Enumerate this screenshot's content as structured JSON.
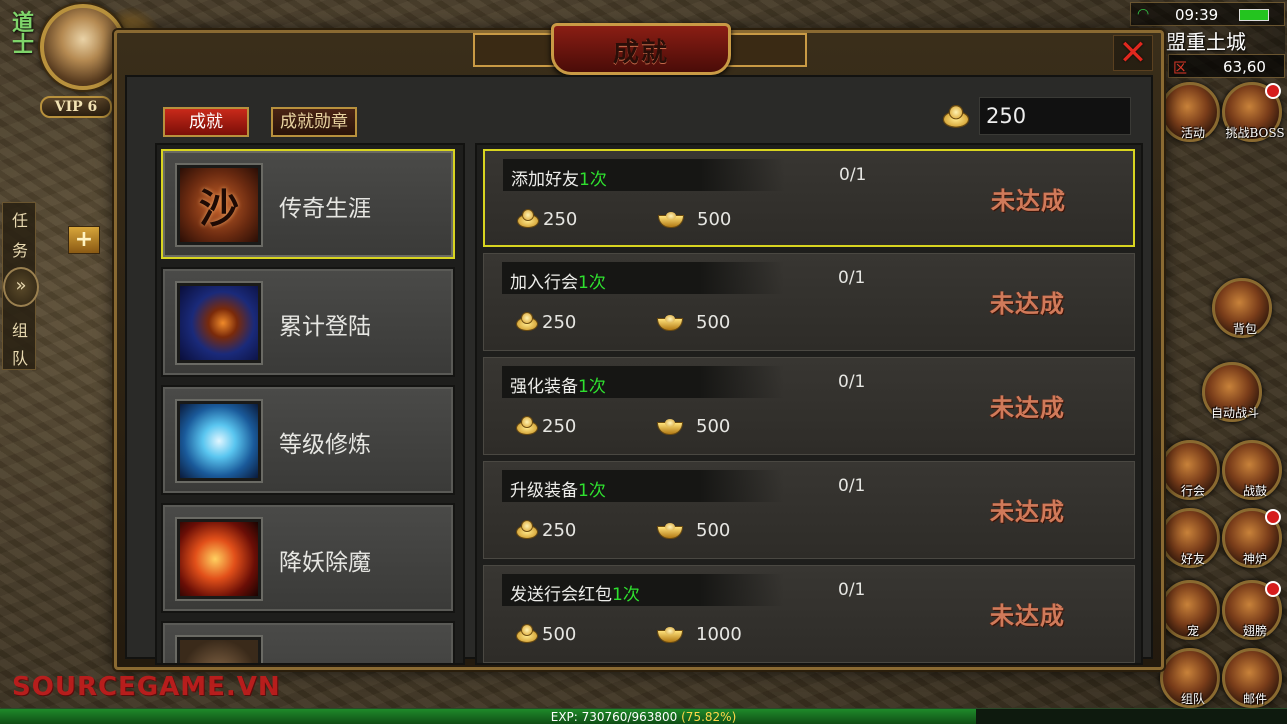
{
  "hud": {
    "player_class": "道士",
    "vip_label": "VIP 6",
    "clock": "09:39",
    "map_name": "盟重土城",
    "zone": "区",
    "coordinates": "63,60",
    "left_tabs": [
      "任",
      "务",
      "组",
      "队"
    ],
    "side_buttons": [
      {
        "label": "活动",
        "badge": false
      },
      {
        "label": "挑战BOSS",
        "badge": true
      },
      {
        "label": "背包",
        "badge": false
      },
      {
        "label": "自动战斗",
        "badge": false
      },
      {
        "label": "行会",
        "badge": false
      },
      {
        "label": "战鼓",
        "badge": false
      },
      {
        "label": "好友",
        "badge": false
      },
      {
        "label": "神炉",
        "badge": true
      },
      {
        "label": "宠",
        "badge": false
      },
      {
        "label": "翅膀",
        "badge": true
      },
      {
        "label": "组队",
        "badge": false
      },
      {
        "label": "邮件",
        "badge": false
      }
    ],
    "exp_text": "EXP: 730760/963800",
    "exp_percent_text": "(75.82%)",
    "exp_fraction": 0.7582,
    "watermark": "SOURCEGAME.VN"
  },
  "dialog": {
    "title": "成就",
    "close_icon": "close-icon",
    "tabs": [
      {
        "label": "成就",
        "active": true
      },
      {
        "label": "成就勋章",
        "active": false
      }
    ],
    "balance": "250",
    "categories": [
      {
        "label": "传奇生涯",
        "icon": "sha-emblem-icon",
        "glyph": "沙",
        "selected": true
      },
      {
        "label": "累计登陆",
        "icon": "phone-card-icon",
        "selected": false
      },
      {
        "label": "等级修炼",
        "icon": "meditation-icon",
        "selected": false
      },
      {
        "label": "降妖除魔",
        "icon": "flame-blade-icon",
        "selected": false
      },
      {
        "label": "",
        "icon": "weapon-icon",
        "selected": false
      }
    ],
    "achievements": [
      {
        "title": "添加好友",
        "count": "1次",
        "progress": "0/1",
        "coin_reward": "250",
        "ingot_reward": "500",
        "status": "未达成",
        "selected": true
      },
      {
        "title": "加入行会",
        "count": "1次",
        "progress": "0/1",
        "coin_reward": "250",
        "ingot_reward": "500",
        "status": "未达成",
        "selected": false
      },
      {
        "title": "强化装备",
        "count": "1次",
        "progress": "0/1",
        "coin_reward": "250",
        "ingot_reward": "500",
        "status": "未达成",
        "selected": false
      },
      {
        "title": "升级装备",
        "count": "1次",
        "progress": "0/1",
        "coin_reward": "250",
        "ingot_reward": "500",
        "status": "未达成",
        "selected": false
      },
      {
        "title": "发送行会红包",
        "count": "1次",
        "progress": "0/1",
        "coin_reward": "500",
        "ingot_reward": "1000",
        "status": "未达成",
        "selected": false
      }
    ]
  },
  "colors": {
    "accent_red": "#c92a1a",
    "gold_border": "#b8913d",
    "selected_border": "#d8d420",
    "count_green": "#2fe02f",
    "status_text": "#d07a5a"
  }
}
